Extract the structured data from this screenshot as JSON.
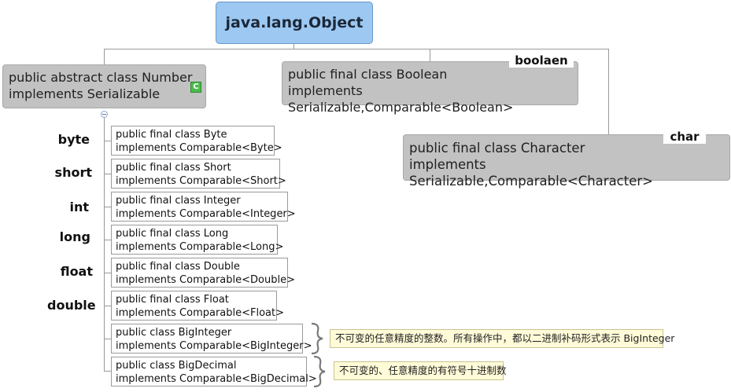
{
  "root": {
    "title": "java.lang.Object"
  },
  "number": {
    "line1": "public abstract class Number",
    "line2": "implements Serializable",
    "badge": "C",
    "badge_icon": "class-icon"
  },
  "boolean": {
    "tag": "boolaen",
    "line1": "public final class Boolean",
    "line2": "implements Serializable,Comparable<Boolean>"
  },
  "character": {
    "tag": "char",
    "line1": "public final class Character",
    "line2": "implements Serializable,Comparable<Character>"
  },
  "subclasses": [
    {
      "label": "byte",
      "line1": "public final class Byte",
      "line2": "implements Comparable<Byte>"
    },
    {
      "label": "short",
      "line1": "public final class Short",
      "line2": "implements Comparable<Short>"
    },
    {
      "label": "int",
      "line1": "public final class Integer",
      "line2": "implements Comparable<Integer>"
    },
    {
      "label": "long",
      "line1": "public final class Long",
      "line2": "implements Comparable<Long>"
    },
    {
      "label": "float",
      "line1": "public final class Double",
      "line2": "implements Comparable<Double>"
    },
    {
      "label": "double",
      "line1": "public final class Float",
      "line2": "implements Comparable<Float>"
    },
    {
      "label": "",
      "line1": "public class BigInteger",
      "line2": "implements Comparable<BigInteger>"
    },
    {
      "label": "",
      "line1": "public class BigDecimal",
      "line2": "implements Comparable<BigDecimal>"
    }
  ],
  "notes": {
    "biginteger": "不可变的任意精度的整数。所有操作中，都以二进制补码形式表示 BigInteger",
    "bigdecimal": "不可变的、任意精度的有符号十进制数"
  }
}
